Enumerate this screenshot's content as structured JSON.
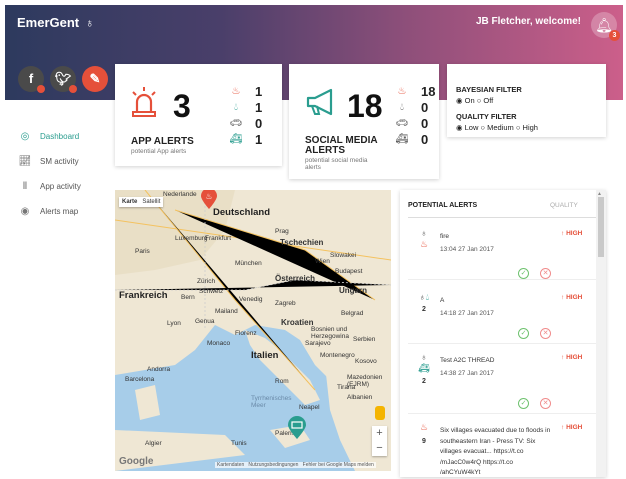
{
  "header": {
    "brand": "EmerGent",
    "brand_icon": "siren-icon",
    "welcome": "JB Fletcher, welcome!",
    "bell_count": "3"
  },
  "social": [
    {
      "label": "f",
      "color": "#4a4a4a"
    },
    {
      "label": "t",
      "color": "#4a4a4a"
    },
    {
      "label": "✎",
      "color": "#e5503a"
    }
  ],
  "nav": {
    "items": [
      {
        "label": "Dashboard",
        "icon": "gauge-icon",
        "active": true
      },
      {
        "label": "SM activity",
        "icon": "line-chart-icon"
      },
      {
        "label": "App activity",
        "icon": "bar-chart-icon"
      },
      {
        "label": "Alerts map",
        "icon": "map-pin-icon"
      }
    ]
  },
  "app_card": {
    "count": "3",
    "title": "APP ALERTS",
    "subtitle": "potential App alerts",
    "counts": [
      "1",
      "1",
      "0",
      "1"
    ]
  },
  "social_card": {
    "count": "18",
    "title1": "SOCIAL MEDIA",
    "title2": "ALERTS",
    "subtitle": "potential social media alerts",
    "counts": [
      "18",
      "0",
      "0",
      "0"
    ]
  },
  "filters": {
    "bayes_title": "BAYESIAN FILTER",
    "bayes_on": "On",
    "bayes_off": "Off",
    "quality_title": "QUALITY FILTER",
    "q_low": "Low",
    "q_medium": "Medium",
    "q_high": "High"
  },
  "map": {
    "karte": "Karte",
    "satellit": "Satellit",
    "google": "Google",
    "attrib1": "Kartendaten",
    "attrib2": "Nutzungsbedingungen",
    "attrib3": "Fehler bei Google Maps melden",
    "zoom_in": "+",
    "zoom_out": "−",
    "labels": [
      "Nederlande",
      "Deutschland",
      "Paris",
      "Frankreich",
      "Luxemburg",
      "Frankfurt",
      "Prag",
      "Tschechien",
      "München",
      "Österreich",
      "Wien",
      "Slowakei",
      "Budapest",
      "Ungarn",
      "Schweiz",
      "Zürich",
      "Lyon",
      "Mailand",
      "Kroatien",
      "Bosnien und Herzegowina",
      "Serbien",
      "Monaco",
      "Italien",
      "Montenegro",
      "Kosovo",
      "Rom",
      "Mazedonien (EJRM)",
      "Albanien",
      "Andorra",
      "Barcelona",
      "Tyrrhenisches Meer",
      "Algier",
      "Tunis",
      "Tirana",
      "Sarajevo",
      "Belgrad",
      "Zagreb",
      "Venedig",
      "Florenz",
      "Neapel",
      "Palermo",
      "Genua",
      "Bern"
    ]
  },
  "alerts": {
    "header": "POTENTIAL ALERTS",
    "quality_header": "QUALITY",
    "items": [
      {
        "text": "fire",
        "time": "13:04 27 Jan 2017",
        "level": "HIGH",
        "count": ""
      },
      {
        "text": "A",
        "time": "14:18 27 Jan 2017",
        "level": "HIGH",
        "count": "2"
      },
      {
        "text": "Test A2C THREAD",
        "time": "14:38 27 Jan 2017",
        "level": "HIGH",
        "count": "2"
      },
      {
        "text": "Six villages evacuated due to floods in southeastern Iran - Press TV: Six villages evacuat... https://t.co /mJacC0w4rQ https://t.co /ahCYuW4kYt",
        "time": "",
        "level": "HIGH",
        "count": "9"
      }
    ]
  }
}
